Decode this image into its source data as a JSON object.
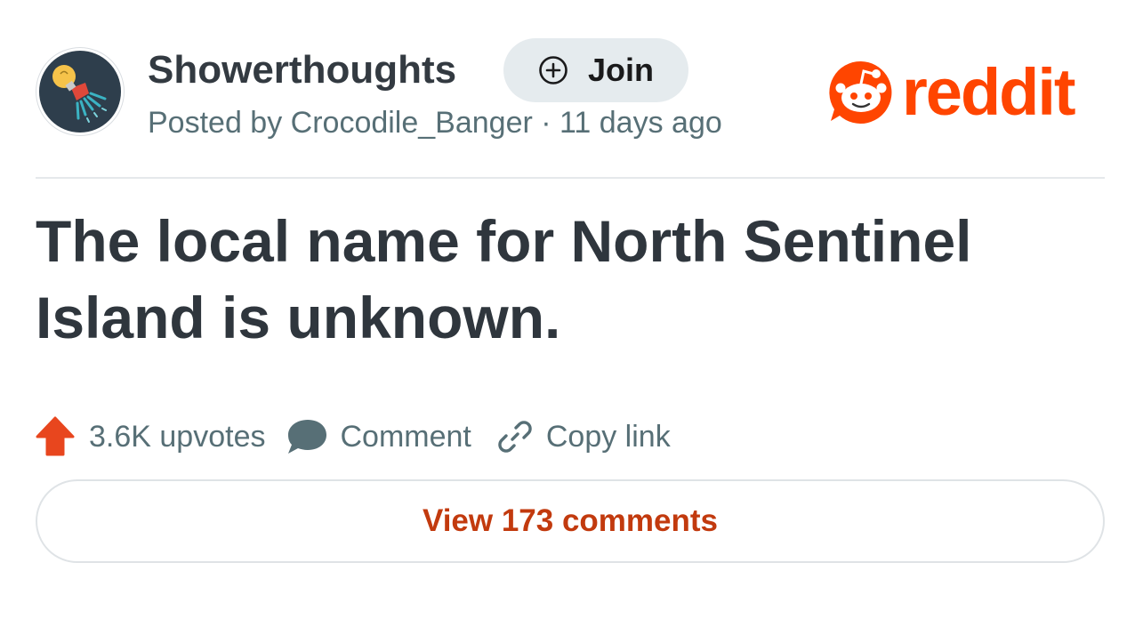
{
  "post": {
    "subreddit": "Showerthoughts",
    "join_label": "Join",
    "meta": "Posted by Crocodile_Banger · 11 days ago",
    "title": "The local name for North Sentinel Island is unknown.",
    "upvotes": "3.6K upvotes",
    "comment_label": "Comment",
    "copy_link_label": "Copy link",
    "view_comments_label": "View 173 comments"
  },
  "brand": {
    "wordmark": "reddit",
    "color": "#ff4500"
  },
  "icons": {
    "avatar": "lightbulb-shower-icon",
    "join": "plus-circle-icon",
    "upvote": "upvote-arrow-icon",
    "comment": "comment-bubble-icon",
    "copy": "link-icon",
    "logo": "snoo-icon"
  },
  "colors": {
    "accent": "#ff4500",
    "link_text": "#c23a0e",
    "muted": "#576f76",
    "join_bg": "#e5ebee",
    "avatar_bg": "#2e3e4c"
  }
}
